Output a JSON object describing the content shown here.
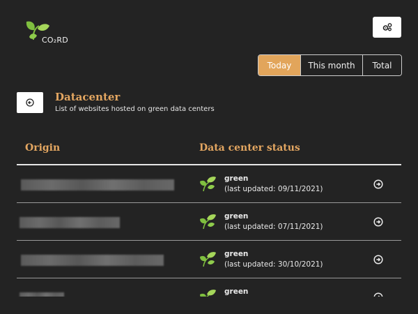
{
  "brand": {
    "logo_text": "CO₂RD"
  },
  "toolbar": {
    "settings_icon": "gears-icon"
  },
  "period_tabs": [
    {
      "label": "Today",
      "active": true
    },
    {
      "label": "This month",
      "active": false
    },
    {
      "label": "Total",
      "active": false
    }
  ],
  "page": {
    "back_icon": "circle-arrow-left-icon",
    "title": "Datacenter",
    "subtitle": "List of websites hosted on green data centers"
  },
  "table": {
    "columns": {
      "origin": "Origin",
      "status": "Data center status"
    },
    "rows": [
      {
        "status": "green",
        "updated": "(last updated: 09/11/2021)"
      },
      {
        "status": "green",
        "updated": "(last updated: 07/11/2021)"
      },
      {
        "status": "green",
        "updated": "(last updated: 30/10/2021)"
      },
      {
        "status": "green",
        "updated": ""
      }
    ]
  },
  "colors": {
    "background": "#232323",
    "accent": "#e2a55b",
    "heading": "#e3a661",
    "leaf_green": "#8bc34a"
  }
}
